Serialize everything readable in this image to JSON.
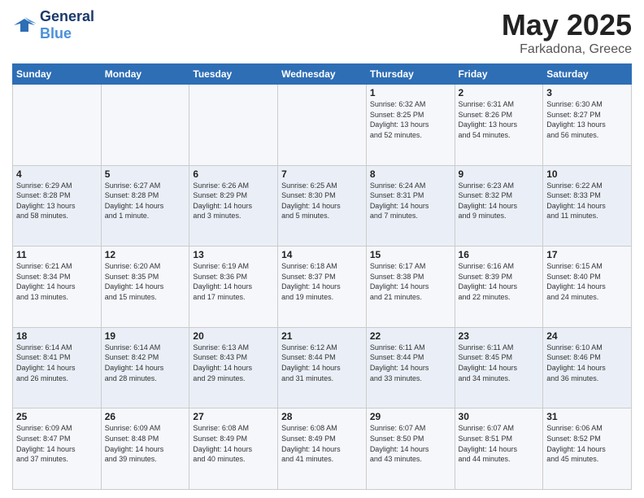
{
  "header": {
    "logo_general": "General",
    "logo_blue": "Blue",
    "month_title": "May 2025",
    "subtitle": "Farkadona, Greece"
  },
  "weekdays": [
    "Sunday",
    "Monday",
    "Tuesday",
    "Wednesday",
    "Thursday",
    "Friday",
    "Saturday"
  ],
  "weeks": [
    [
      {
        "day": "",
        "info": ""
      },
      {
        "day": "",
        "info": ""
      },
      {
        "day": "",
        "info": ""
      },
      {
        "day": "",
        "info": ""
      },
      {
        "day": "1",
        "info": "Sunrise: 6:32 AM\nSunset: 8:25 PM\nDaylight: 13 hours\nand 52 minutes."
      },
      {
        "day": "2",
        "info": "Sunrise: 6:31 AM\nSunset: 8:26 PM\nDaylight: 13 hours\nand 54 minutes."
      },
      {
        "day": "3",
        "info": "Sunrise: 6:30 AM\nSunset: 8:27 PM\nDaylight: 13 hours\nand 56 minutes."
      }
    ],
    [
      {
        "day": "4",
        "info": "Sunrise: 6:29 AM\nSunset: 8:28 PM\nDaylight: 13 hours\nand 58 minutes."
      },
      {
        "day": "5",
        "info": "Sunrise: 6:27 AM\nSunset: 8:28 PM\nDaylight: 14 hours\nand 1 minute."
      },
      {
        "day": "6",
        "info": "Sunrise: 6:26 AM\nSunset: 8:29 PM\nDaylight: 14 hours\nand 3 minutes."
      },
      {
        "day": "7",
        "info": "Sunrise: 6:25 AM\nSunset: 8:30 PM\nDaylight: 14 hours\nand 5 minutes."
      },
      {
        "day": "8",
        "info": "Sunrise: 6:24 AM\nSunset: 8:31 PM\nDaylight: 14 hours\nand 7 minutes."
      },
      {
        "day": "9",
        "info": "Sunrise: 6:23 AM\nSunset: 8:32 PM\nDaylight: 14 hours\nand 9 minutes."
      },
      {
        "day": "10",
        "info": "Sunrise: 6:22 AM\nSunset: 8:33 PM\nDaylight: 14 hours\nand 11 minutes."
      }
    ],
    [
      {
        "day": "11",
        "info": "Sunrise: 6:21 AM\nSunset: 8:34 PM\nDaylight: 14 hours\nand 13 minutes."
      },
      {
        "day": "12",
        "info": "Sunrise: 6:20 AM\nSunset: 8:35 PM\nDaylight: 14 hours\nand 15 minutes."
      },
      {
        "day": "13",
        "info": "Sunrise: 6:19 AM\nSunset: 8:36 PM\nDaylight: 14 hours\nand 17 minutes."
      },
      {
        "day": "14",
        "info": "Sunrise: 6:18 AM\nSunset: 8:37 PM\nDaylight: 14 hours\nand 19 minutes."
      },
      {
        "day": "15",
        "info": "Sunrise: 6:17 AM\nSunset: 8:38 PM\nDaylight: 14 hours\nand 21 minutes."
      },
      {
        "day": "16",
        "info": "Sunrise: 6:16 AM\nSunset: 8:39 PM\nDaylight: 14 hours\nand 22 minutes."
      },
      {
        "day": "17",
        "info": "Sunrise: 6:15 AM\nSunset: 8:40 PM\nDaylight: 14 hours\nand 24 minutes."
      }
    ],
    [
      {
        "day": "18",
        "info": "Sunrise: 6:14 AM\nSunset: 8:41 PM\nDaylight: 14 hours\nand 26 minutes."
      },
      {
        "day": "19",
        "info": "Sunrise: 6:14 AM\nSunset: 8:42 PM\nDaylight: 14 hours\nand 28 minutes."
      },
      {
        "day": "20",
        "info": "Sunrise: 6:13 AM\nSunset: 8:43 PM\nDaylight: 14 hours\nand 29 minutes."
      },
      {
        "day": "21",
        "info": "Sunrise: 6:12 AM\nSunset: 8:44 PM\nDaylight: 14 hours\nand 31 minutes."
      },
      {
        "day": "22",
        "info": "Sunrise: 6:11 AM\nSunset: 8:44 PM\nDaylight: 14 hours\nand 33 minutes."
      },
      {
        "day": "23",
        "info": "Sunrise: 6:11 AM\nSunset: 8:45 PM\nDaylight: 14 hours\nand 34 minutes."
      },
      {
        "day": "24",
        "info": "Sunrise: 6:10 AM\nSunset: 8:46 PM\nDaylight: 14 hours\nand 36 minutes."
      }
    ],
    [
      {
        "day": "25",
        "info": "Sunrise: 6:09 AM\nSunset: 8:47 PM\nDaylight: 14 hours\nand 37 minutes."
      },
      {
        "day": "26",
        "info": "Sunrise: 6:09 AM\nSunset: 8:48 PM\nDaylight: 14 hours\nand 39 minutes."
      },
      {
        "day": "27",
        "info": "Sunrise: 6:08 AM\nSunset: 8:49 PM\nDaylight: 14 hours\nand 40 minutes."
      },
      {
        "day": "28",
        "info": "Sunrise: 6:08 AM\nSunset: 8:49 PM\nDaylight: 14 hours\nand 41 minutes."
      },
      {
        "day": "29",
        "info": "Sunrise: 6:07 AM\nSunset: 8:50 PM\nDaylight: 14 hours\nand 43 minutes."
      },
      {
        "day": "30",
        "info": "Sunrise: 6:07 AM\nSunset: 8:51 PM\nDaylight: 14 hours\nand 44 minutes."
      },
      {
        "day": "31",
        "info": "Sunrise: 6:06 AM\nSunset: 8:52 PM\nDaylight: 14 hours\nand 45 minutes."
      }
    ]
  ]
}
